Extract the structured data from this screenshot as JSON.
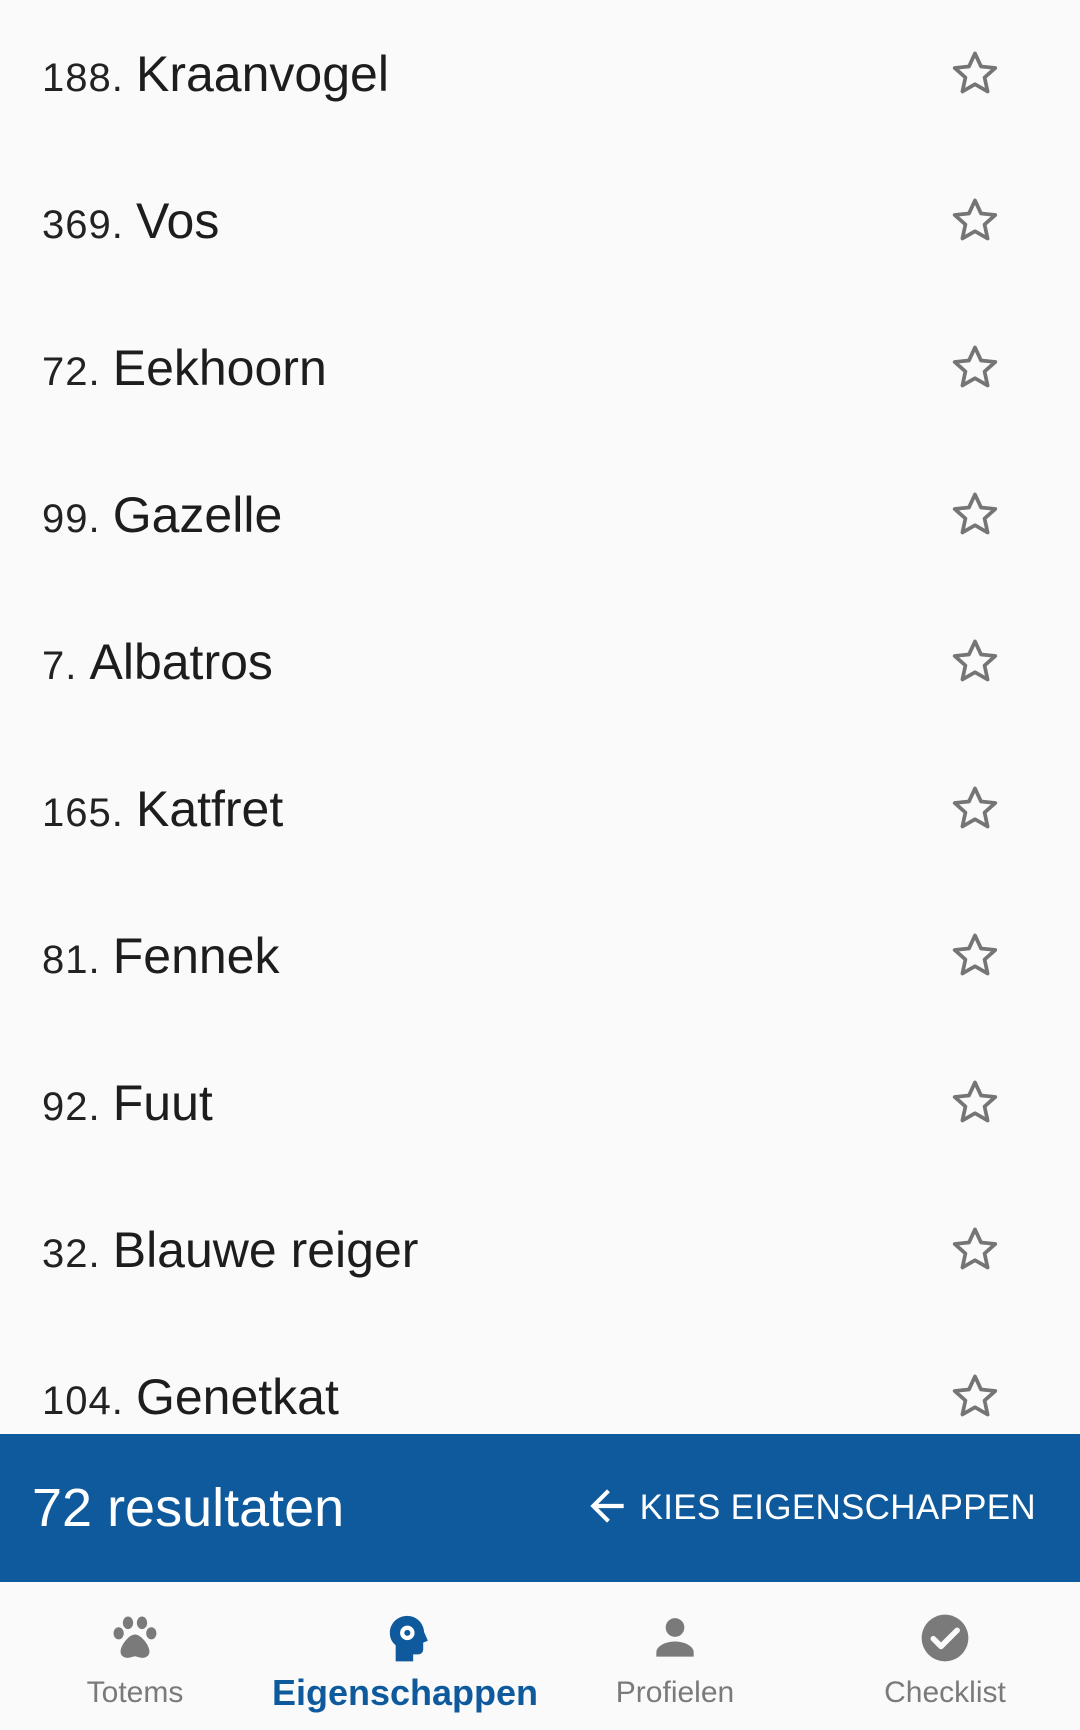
{
  "list": {
    "items": [
      {
        "number": "188.",
        "name": "Kraanvogel"
      },
      {
        "number": "369.",
        "name": "Vos"
      },
      {
        "number": "72.",
        "name": "Eekhoorn"
      },
      {
        "number": "99.",
        "name": "Gazelle"
      },
      {
        "number": "7.",
        "name": "Albatros"
      },
      {
        "number": "165.",
        "name": "Katfret"
      },
      {
        "number": "81.",
        "name": "Fennek"
      },
      {
        "number": "92.",
        "name": "Fuut"
      },
      {
        "number": "32.",
        "name": "Blauwe reiger"
      },
      {
        "number": "104.",
        "name": "Genetkat"
      }
    ],
    "star_icon": "star-outline-icon"
  },
  "results_bar": {
    "count_label": "72 resultaten",
    "choose_label": "KIES EIGENSCHAPPEN",
    "arrow_icon": "arrow-left-icon",
    "background": "#0f5a9c"
  },
  "bottom_nav": {
    "items": [
      {
        "label": "Totems",
        "icon": "paw-icon",
        "active": false
      },
      {
        "label": "Eigenschappen",
        "icon": "head-gear-icon",
        "active": true
      },
      {
        "label": "Profielen",
        "icon": "person-icon",
        "active": false
      },
      {
        "label": "Checklist",
        "icon": "check-circle-icon",
        "active": false
      }
    ],
    "active_color": "#0f5a9c",
    "inactive_color": "#7a7a7a"
  }
}
